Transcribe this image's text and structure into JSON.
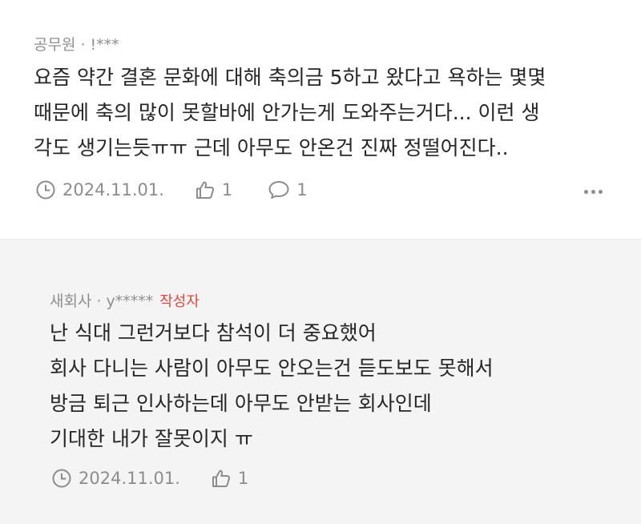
{
  "comments": [
    {
      "author": "공무원",
      "separator": "·",
      "user_id": "!***",
      "lines": [
        "요즘 약간 결혼 문화에 대해 축의금 5하고 왔다고 욕하는 몇몇",
        "때문에 축의 많이 못할바에 안가는게 도와주는거다... 이런 생",
        "각도 생기는듯ㅠㅠ 근데 아무도 안온건 진짜 정떨어진다.."
      ],
      "date": "2024.11.01.",
      "likes": "1",
      "replies": "1",
      "icons": {
        "date": "clock-icon",
        "likes": "thumbs-up-icon",
        "replies": "speech-bubble-icon",
        "more": "more-dots-icon"
      }
    },
    {
      "author": "새회사",
      "separator": "·",
      "user_id": "y*****",
      "badge": "작성자",
      "lines": [
        "난 식대 그런거보다 참석이 더 중요했어",
        "회사 다니는 사람이 아무도 안오는건 듣도보도 못해서",
        "방금 퇴근 인사하는데 아무도 안받는 회사인데",
        "기대한 내가 잘못이지 ㅠ"
      ],
      "date": "2024.11.01.",
      "likes": "1",
      "icons": {
        "date": "clock-icon",
        "likes": "thumbs-up-icon"
      }
    }
  ],
  "colors": {
    "badge": "#e0473a",
    "meta": "#8f8f8f",
    "body": "#262626",
    "reply_bg": "#f4f4f4"
  }
}
